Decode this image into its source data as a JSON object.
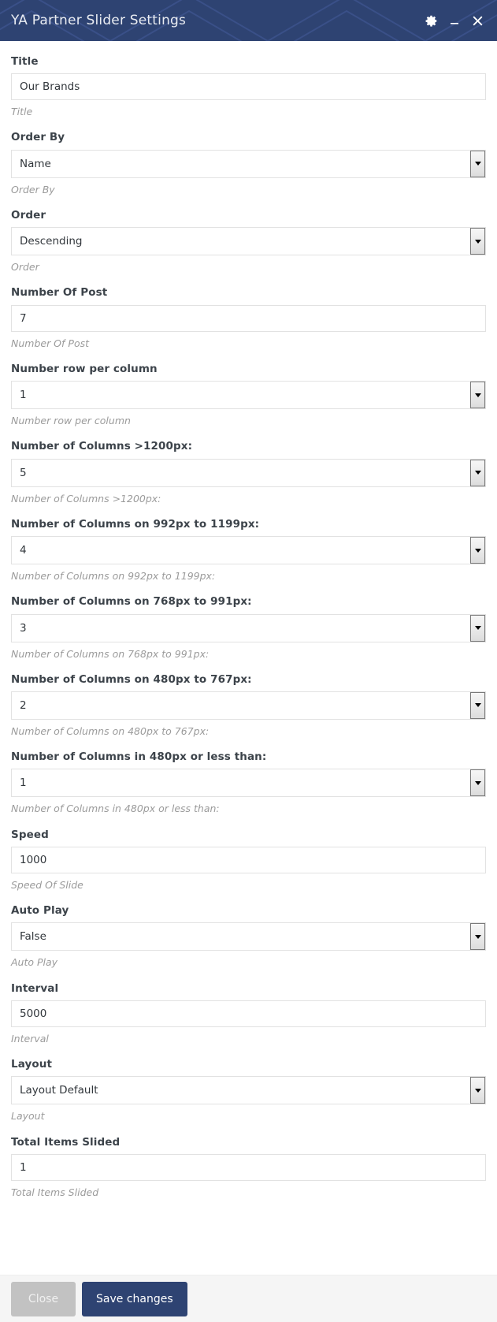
{
  "header": {
    "title": "YA Partner Slider Settings",
    "background_color": "#2e4372",
    "icons": [
      {
        "name": "gear-icon",
        "label": "Settings"
      },
      {
        "name": "minimize-icon",
        "label": "Minimize"
      },
      {
        "name": "close-icon",
        "label": "Close"
      }
    ]
  },
  "form": {
    "fields": [
      {
        "label": "Title",
        "type": "text",
        "value": "Our Brands",
        "help": "Title"
      },
      {
        "label": "Order By",
        "type": "select",
        "value": "Name",
        "help": "Order By"
      },
      {
        "label": "Order",
        "type": "select",
        "value": "Descending",
        "help": "Order"
      },
      {
        "label": "Number Of Post",
        "type": "text",
        "value": "7",
        "help": "Number Of Post"
      },
      {
        "label": "Number row per column",
        "type": "select",
        "value": "1",
        "help": "Number row per column"
      },
      {
        "label": "Number of Columns >1200px:",
        "type": "select",
        "value": "5",
        "help": "Number of Columns >1200px:"
      },
      {
        "label": "Number of Columns on 992px to 1199px:",
        "type": "select",
        "value": "4",
        "help": "Number of Columns on 992px to 1199px:"
      },
      {
        "label": "Number of Columns on 768px to 991px:",
        "type": "select",
        "value": "3",
        "help": "Number of Columns on 768px to 991px:"
      },
      {
        "label": "Number of Columns on 480px to 767px:",
        "type": "select",
        "value": "2",
        "help": "Number of Columns on 480px to 767px:"
      },
      {
        "label": "Number of Columns in 480px or less than:",
        "type": "select",
        "value": "1",
        "help": "Number of Columns in 480px or less than:"
      },
      {
        "label": "Speed",
        "type": "text",
        "value": "1000",
        "help": "Speed Of Slide"
      },
      {
        "label": "Auto Play",
        "type": "select",
        "value": "False",
        "help": "Auto Play"
      },
      {
        "label": "Interval",
        "type": "text",
        "value": "5000",
        "help": "Interval"
      },
      {
        "label": "Layout",
        "type": "select",
        "value": "Layout Default",
        "help": "Layout"
      },
      {
        "label": "Total Items Slided",
        "type": "text",
        "value": "1",
        "help": "Total Items Slided"
      }
    ]
  },
  "footer": {
    "close_label": "Close",
    "save_label": "Save changes",
    "close_color": "#c2c2c2",
    "save_color": "#2e4372"
  }
}
